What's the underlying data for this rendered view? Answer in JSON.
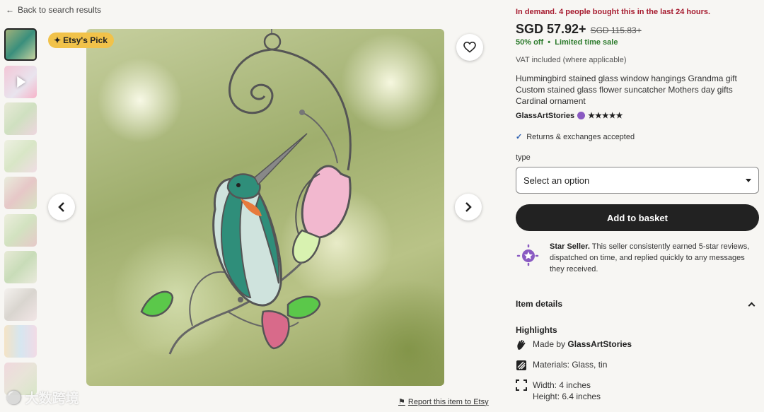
{
  "nav": {
    "back_label": "Back to search results"
  },
  "gallery": {
    "badge_label": "Etsy's Pick",
    "report_label": "Report this item to Etsy",
    "thumbnail_count": 10
  },
  "product": {
    "demand_text": "In demand. 4 people bought this in the last 24 hours.",
    "price": "SGD 57.92+",
    "original_price": "SGD 115.83+",
    "discount": "50% off",
    "sale_label": "Limited time sale",
    "vat_note": "VAT included (where applicable)",
    "title": "Hummingbird stained glass window hangings Grandma gift Custom stained glass flower suncatcher Mothers day gifts Cardinal ornament",
    "shop_name": "GlassArtStories",
    "rating_stars": "★★★★★",
    "returns_text": "Returns & exchanges accepted"
  },
  "options": {
    "type_label": "type",
    "select_placeholder": "Select an option"
  },
  "actions": {
    "add_to_basket": "Add to basket"
  },
  "star_seller": {
    "title": "Star Seller.",
    "description": "This seller consistently earned 5-star reviews, dispatched on time, and replied quickly to any messages they received."
  },
  "item_details": {
    "heading": "Item details",
    "highlights_heading": "Highlights",
    "made_by_prefix": "Made by",
    "made_by_shop": "GlassArtStories",
    "materials": "Materials: Glass, tin",
    "width": "Width: 4 inches",
    "height": "Height: 6.4 inches"
  },
  "watermark": {
    "text": "大数跨境"
  },
  "colors": {
    "demand": "#a61a2e",
    "sale": "#2b7a2b",
    "badge": "#f1c24a",
    "button": "#222222"
  }
}
